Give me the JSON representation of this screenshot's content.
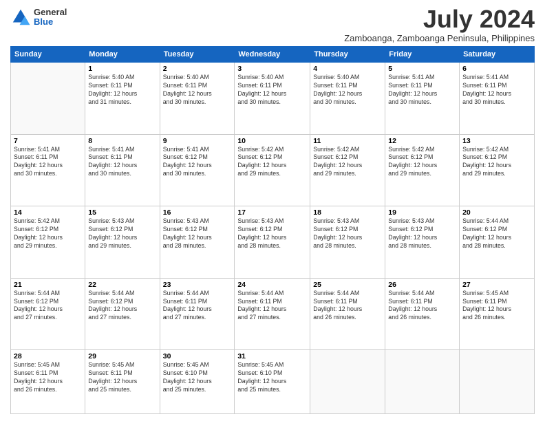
{
  "logo": {
    "general": "General",
    "blue": "Blue"
  },
  "title": "July 2024",
  "subtitle": "Zamboanga, Zamboanga Peninsula, Philippines",
  "days_of_week": [
    "Sunday",
    "Monday",
    "Tuesday",
    "Wednesday",
    "Thursday",
    "Friday",
    "Saturday"
  ],
  "weeks": [
    [
      {
        "num": "",
        "detail": ""
      },
      {
        "num": "1",
        "detail": "Sunrise: 5:40 AM\nSunset: 6:11 PM\nDaylight: 12 hours\nand 31 minutes."
      },
      {
        "num": "2",
        "detail": "Sunrise: 5:40 AM\nSunset: 6:11 PM\nDaylight: 12 hours\nand 30 minutes."
      },
      {
        "num": "3",
        "detail": "Sunrise: 5:40 AM\nSunset: 6:11 PM\nDaylight: 12 hours\nand 30 minutes."
      },
      {
        "num": "4",
        "detail": "Sunrise: 5:40 AM\nSunset: 6:11 PM\nDaylight: 12 hours\nand 30 minutes."
      },
      {
        "num": "5",
        "detail": "Sunrise: 5:41 AM\nSunset: 6:11 PM\nDaylight: 12 hours\nand 30 minutes."
      },
      {
        "num": "6",
        "detail": "Sunrise: 5:41 AM\nSunset: 6:11 PM\nDaylight: 12 hours\nand 30 minutes."
      }
    ],
    [
      {
        "num": "7",
        "detail": "Sunrise: 5:41 AM\nSunset: 6:11 PM\nDaylight: 12 hours\nand 30 minutes."
      },
      {
        "num": "8",
        "detail": "Sunrise: 5:41 AM\nSunset: 6:11 PM\nDaylight: 12 hours\nand 30 minutes."
      },
      {
        "num": "9",
        "detail": "Sunrise: 5:41 AM\nSunset: 6:12 PM\nDaylight: 12 hours\nand 30 minutes."
      },
      {
        "num": "10",
        "detail": "Sunrise: 5:42 AM\nSunset: 6:12 PM\nDaylight: 12 hours\nand 29 minutes."
      },
      {
        "num": "11",
        "detail": "Sunrise: 5:42 AM\nSunset: 6:12 PM\nDaylight: 12 hours\nand 29 minutes."
      },
      {
        "num": "12",
        "detail": "Sunrise: 5:42 AM\nSunset: 6:12 PM\nDaylight: 12 hours\nand 29 minutes."
      },
      {
        "num": "13",
        "detail": "Sunrise: 5:42 AM\nSunset: 6:12 PM\nDaylight: 12 hours\nand 29 minutes."
      }
    ],
    [
      {
        "num": "14",
        "detail": "Sunrise: 5:42 AM\nSunset: 6:12 PM\nDaylight: 12 hours\nand 29 minutes."
      },
      {
        "num": "15",
        "detail": "Sunrise: 5:43 AM\nSunset: 6:12 PM\nDaylight: 12 hours\nand 29 minutes."
      },
      {
        "num": "16",
        "detail": "Sunrise: 5:43 AM\nSunset: 6:12 PM\nDaylight: 12 hours\nand 28 minutes."
      },
      {
        "num": "17",
        "detail": "Sunrise: 5:43 AM\nSunset: 6:12 PM\nDaylight: 12 hours\nand 28 minutes."
      },
      {
        "num": "18",
        "detail": "Sunrise: 5:43 AM\nSunset: 6:12 PM\nDaylight: 12 hours\nand 28 minutes."
      },
      {
        "num": "19",
        "detail": "Sunrise: 5:43 AM\nSunset: 6:12 PM\nDaylight: 12 hours\nand 28 minutes."
      },
      {
        "num": "20",
        "detail": "Sunrise: 5:44 AM\nSunset: 6:12 PM\nDaylight: 12 hours\nand 28 minutes."
      }
    ],
    [
      {
        "num": "21",
        "detail": "Sunrise: 5:44 AM\nSunset: 6:12 PM\nDaylight: 12 hours\nand 27 minutes."
      },
      {
        "num": "22",
        "detail": "Sunrise: 5:44 AM\nSunset: 6:12 PM\nDaylight: 12 hours\nand 27 minutes."
      },
      {
        "num": "23",
        "detail": "Sunrise: 5:44 AM\nSunset: 6:11 PM\nDaylight: 12 hours\nand 27 minutes."
      },
      {
        "num": "24",
        "detail": "Sunrise: 5:44 AM\nSunset: 6:11 PM\nDaylight: 12 hours\nand 27 minutes."
      },
      {
        "num": "25",
        "detail": "Sunrise: 5:44 AM\nSunset: 6:11 PM\nDaylight: 12 hours\nand 26 minutes."
      },
      {
        "num": "26",
        "detail": "Sunrise: 5:44 AM\nSunset: 6:11 PM\nDaylight: 12 hours\nand 26 minutes."
      },
      {
        "num": "27",
        "detail": "Sunrise: 5:45 AM\nSunset: 6:11 PM\nDaylight: 12 hours\nand 26 minutes."
      }
    ],
    [
      {
        "num": "28",
        "detail": "Sunrise: 5:45 AM\nSunset: 6:11 PM\nDaylight: 12 hours\nand 26 minutes."
      },
      {
        "num": "29",
        "detail": "Sunrise: 5:45 AM\nSunset: 6:11 PM\nDaylight: 12 hours\nand 25 minutes."
      },
      {
        "num": "30",
        "detail": "Sunrise: 5:45 AM\nSunset: 6:10 PM\nDaylight: 12 hours\nand 25 minutes."
      },
      {
        "num": "31",
        "detail": "Sunrise: 5:45 AM\nSunset: 6:10 PM\nDaylight: 12 hours\nand 25 minutes."
      },
      {
        "num": "",
        "detail": ""
      },
      {
        "num": "",
        "detail": ""
      },
      {
        "num": "",
        "detail": ""
      }
    ]
  ]
}
